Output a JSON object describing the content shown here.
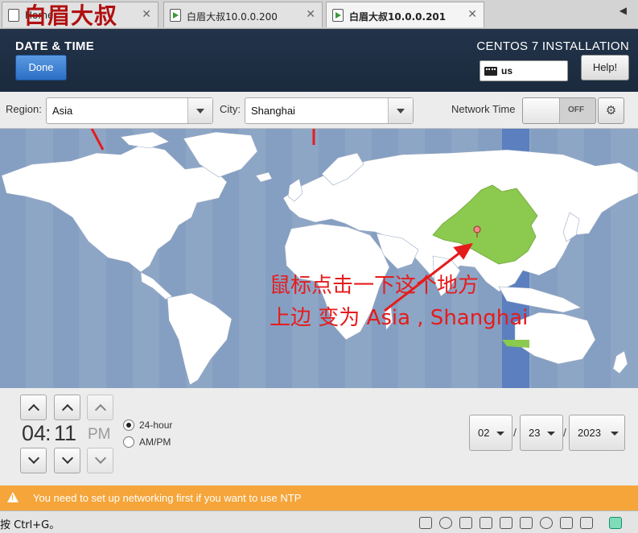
{
  "vm_tabs": [
    {
      "label": "Home",
      "active": false
    },
    {
      "label": "白眉大叔10.0.0.200",
      "active": false
    },
    {
      "label": "白眉大叔10.0.0.201",
      "active": true
    }
  ],
  "watermark": "白眉大叔",
  "header": {
    "title": "DATE & TIME",
    "done_label": "Done",
    "product": "CENTOS 7 INSTALLATION",
    "keyboard_layout": "us",
    "help_label": "Help!"
  },
  "selectors": {
    "region_label": "Region:",
    "region_value": "Asia",
    "city_label": "City:",
    "city_value": "Shanghai",
    "network_time_label": "Network Time",
    "network_time_state": "OFF"
  },
  "annotation": {
    "line1": "鼠标点击一下这个地方",
    "line2": "上边 变为  Asia , Shanghai"
  },
  "time": {
    "hours": "04",
    "separator": ":",
    "minutes": "11",
    "period": "PM",
    "format_24": "24-hour",
    "format_ampm": "AM/PM",
    "selected_format": "24-hour"
  },
  "date": {
    "month": "02",
    "day": "23",
    "year": "2023",
    "separator": "/"
  },
  "warning": "You need to set up networking first if you want to use NTP",
  "vm_status": {
    "hint": "按 Ctrl+G。"
  },
  "colors": {
    "header_bg": "#1b2a3d",
    "done_button": "#2b6fc6",
    "ocean": "#8ea6c6",
    "land": "#ffffff",
    "selected_zone": "#8bc94f",
    "timezone_band": "#6e8ec0",
    "warning_bg": "#f5a53a",
    "annotation_red": "#e51c1c"
  }
}
